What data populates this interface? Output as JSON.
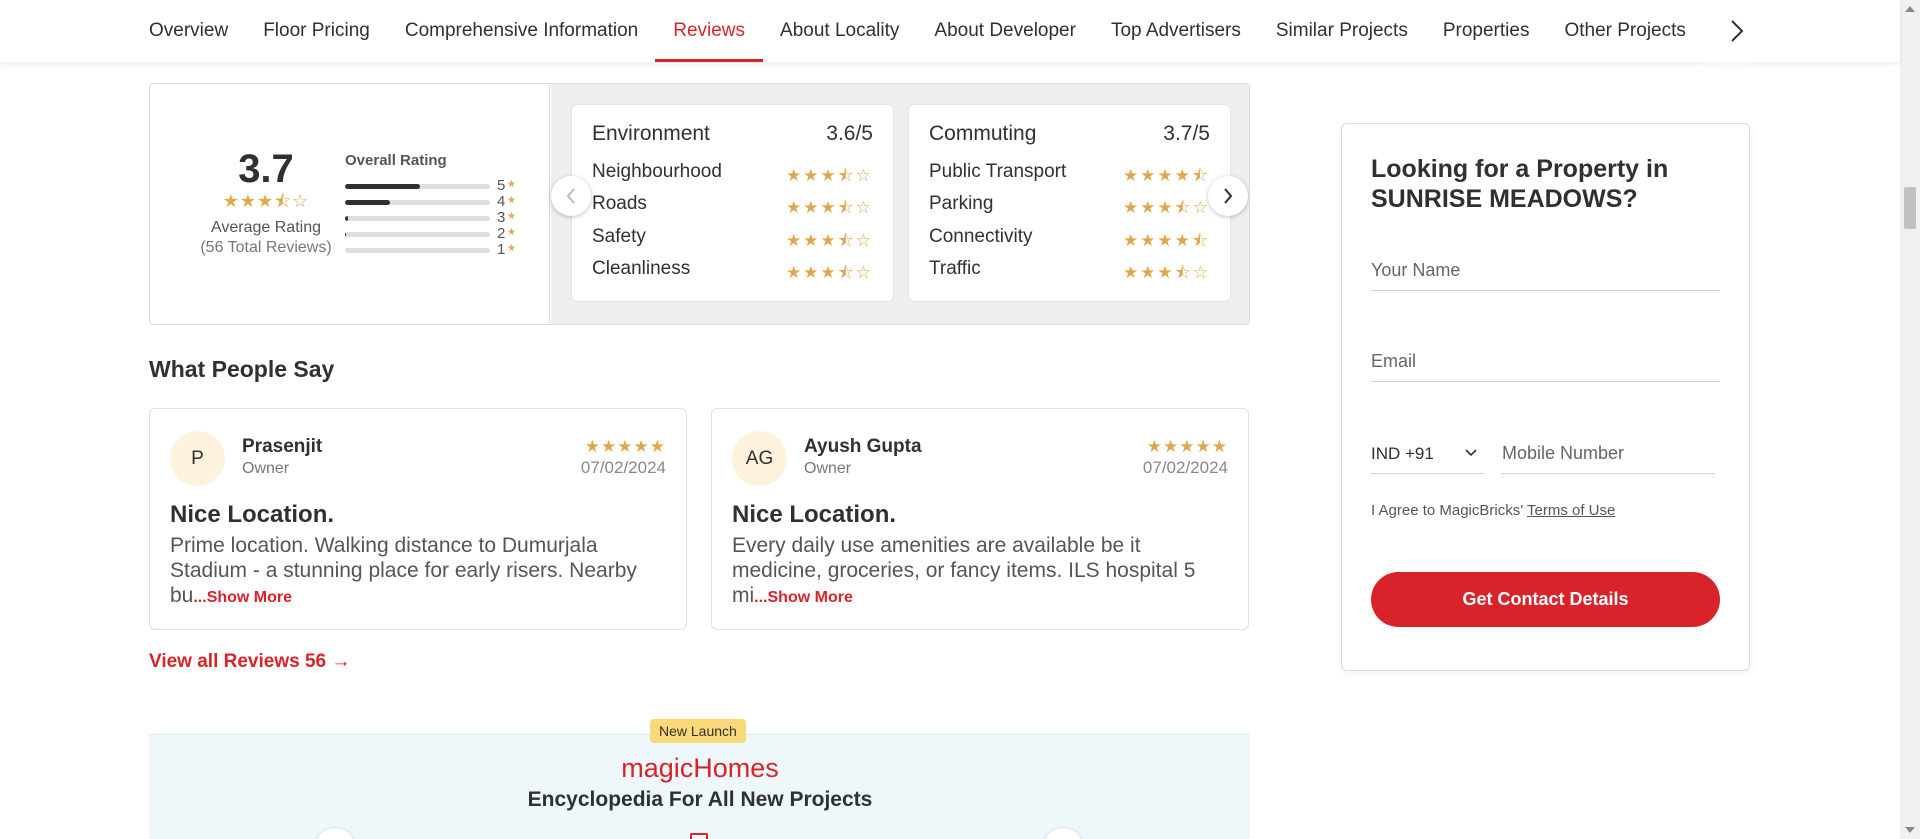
{
  "nav": {
    "tabs": [
      {
        "label": "Overview"
      },
      {
        "label": "Floor Pricing"
      },
      {
        "label": "Comprehensive Information"
      },
      {
        "label": "Reviews"
      },
      {
        "label": "About Locality"
      },
      {
        "label": "About Developer"
      },
      {
        "label": "Top Advertisers"
      },
      {
        "label": "Similar Projects"
      },
      {
        "label": "Properties"
      },
      {
        "label": "Other Projects"
      }
    ],
    "active_tab": "Reviews",
    "next_icon": "chevron-right-icon"
  },
  "rating": {
    "average": "3.7",
    "stars": "★★★⯪☆",
    "average_label": "Average Rating",
    "total_reviews": "(56 Total Reviews)",
    "overall_label": "Overall Rating",
    "distribution": [
      {
        "label": "5",
        "fraction": 0.52
      },
      {
        "label": "4",
        "fraction": 0.31
      },
      {
        "label": "3",
        "fraction": 0.02
      },
      {
        "label": "2",
        "fraction": 0.01
      },
      {
        "label": "1",
        "fraction": 0.0
      }
    ],
    "categories": [
      {
        "name": "Environment",
        "score": "3.6/5",
        "items": [
          {
            "name": "Neighbourhood",
            "stars": "★★★⯪☆"
          },
          {
            "name": "Roads",
            "stars": "★★★⯪☆"
          },
          {
            "name": "Safety",
            "stars": "★★★⯪☆"
          },
          {
            "name": "Cleanliness",
            "stars": "★★★⯪☆"
          }
        ]
      },
      {
        "name": "Commuting",
        "score": "3.7/5",
        "items": [
          {
            "name": "Public Transport",
            "stars": "★★★★⯪"
          },
          {
            "name": "Parking",
            "stars": "★★★⯪☆"
          },
          {
            "name": "Connectivity",
            "stars": "★★★★⯪"
          },
          {
            "name": "Traffic",
            "stars": "★★★⯪☆"
          }
        ]
      }
    ]
  },
  "reviews": {
    "title": "What People Say",
    "items": [
      {
        "initials": "P",
        "name": "Prasenjit",
        "role": "Owner",
        "stars": "★★★★★",
        "date": "07/02/2024",
        "title": "Nice Location.",
        "body": "Prime location. Walking distance to Dumurjala Stadium - a stunning place for early risers. Nearby bu",
        "more": "...Show More"
      },
      {
        "initials": "AG",
        "name": "Ayush Gupta",
        "role": "Owner",
        "stars": "★★★★★",
        "date": "07/02/2024",
        "title": "Nice Location.",
        "body": "Every daily use amenities are available be it medicine, groceries, or fancy items. ILS hospital 5 mi",
        "more": "...Show More"
      }
    ],
    "view_all": "View all Reviews 56 →"
  },
  "banner": {
    "badge": "New Launch",
    "logo": "magicHomes",
    "subtitle": "Encyclopedia For All New Projects"
  },
  "form": {
    "title": "Looking for a Property in SUNRISE MEADOWS?",
    "name_placeholder": "Your Name",
    "email_placeholder": "Email",
    "country_code": "IND +91",
    "mobile_placeholder": "Mobile Number",
    "agree_text": "I Agree to MagicBricks'",
    "terms_link": "Terms of Use",
    "submit": "Get Contact Details"
  },
  "colors": {
    "accent": "#d8232a",
    "star": "#e0a84e"
  }
}
